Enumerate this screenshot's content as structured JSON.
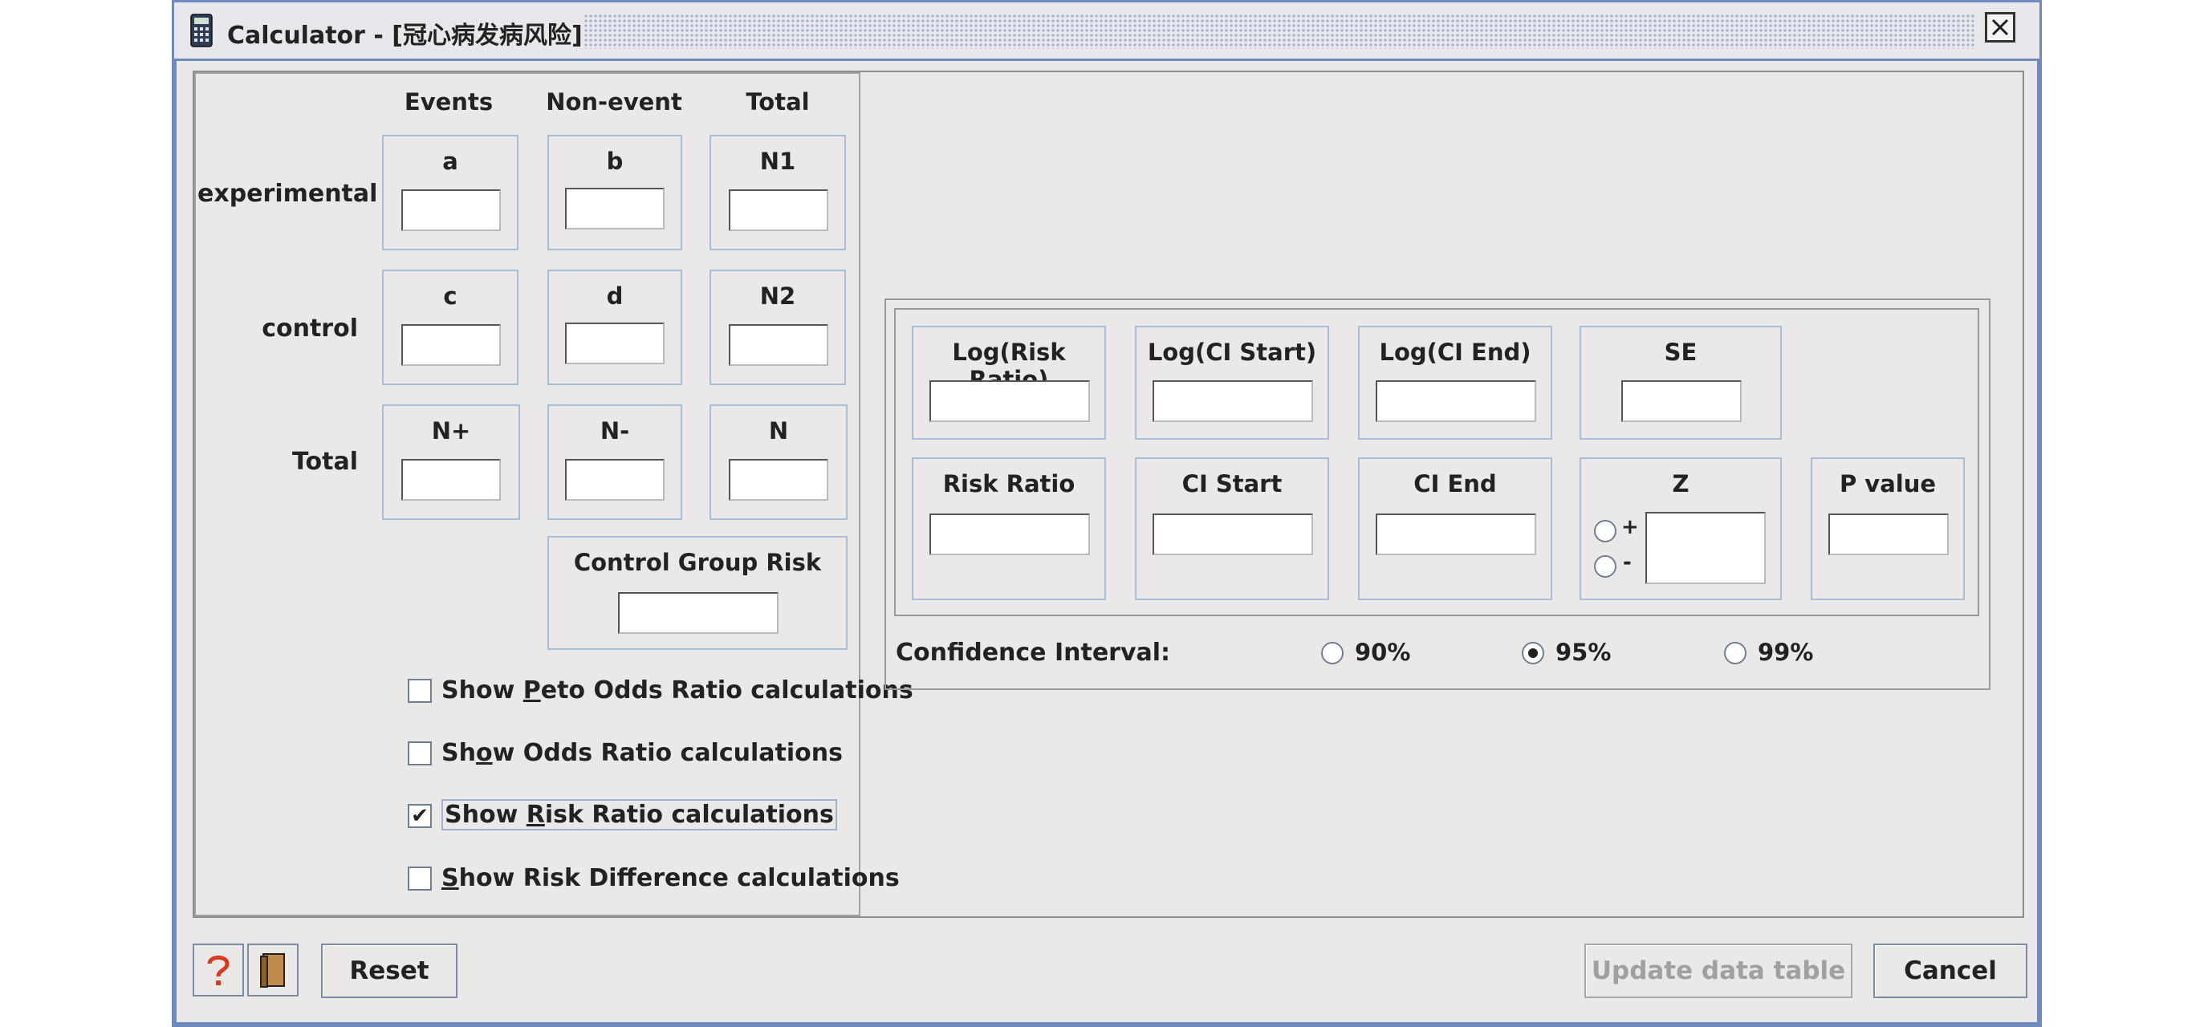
{
  "window": {
    "title": "Calculator - [冠心病发病风险]",
    "app_icon": "calculator-icon",
    "close_icon": "close-icon"
  },
  "table": {
    "headers": [
      "Events",
      "Non-event",
      "Total"
    ],
    "rows": [
      {
        "label": "experimental",
        "cells": [
          "a",
          "b",
          "N1"
        ]
      },
      {
        "label": "control",
        "cells": [
          "c",
          "d",
          "N2"
        ]
      },
      {
        "label": "Total",
        "cells": [
          "N+",
          "N-",
          "N"
        ]
      }
    ],
    "control_group_risk_label": "Control Group Risk"
  },
  "checkboxes": [
    {
      "before": "Show ",
      "mnemonic": "P",
      "after": "eto Odds Ratio calculations",
      "checked": false
    },
    {
      "before": "Sh",
      "mnemonic": "o",
      "after": "w Odds Ratio calculations",
      "checked": false
    },
    {
      "before": "Show ",
      "mnemonic": "R",
      "after": "isk Ratio calculations",
      "checked": true
    },
    {
      "before": "",
      "mnemonic": "S",
      "after": "how Risk Difference calculations",
      "checked": false
    }
  ],
  "checkmark": "✔",
  "results": {
    "row1": [
      "Log(Risk Ratio)",
      "Log(CI Start)",
      "Log(CI End)",
      "SE"
    ],
    "row2": [
      "Risk Ratio",
      "CI Start",
      "CI End",
      "Z",
      "P value"
    ],
    "z_plus": "+",
    "z_minus": "-"
  },
  "confidence": {
    "label": "Confidence Interval:",
    "options": [
      "90%",
      "95%",
      "99%"
    ],
    "selected": "95%"
  },
  "buttons": {
    "help_icon": "help-icon",
    "book_icon": "book-icon",
    "reset": "Reset",
    "update": "Update data table",
    "cancel": "Cancel"
  },
  "colors": {
    "window_frame": "#6f8bbd",
    "field_border": "#a9bed8",
    "background": "#ebe9e7"
  }
}
